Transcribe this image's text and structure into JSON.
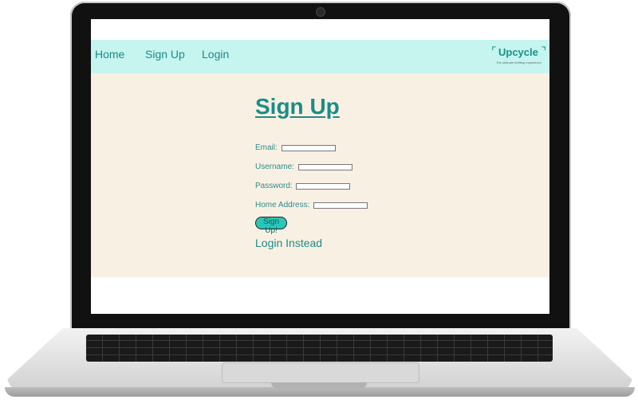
{
  "nav": {
    "home": "Home",
    "signup": "Sign Up",
    "login": "Login"
  },
  "logo": {
    "name": "Upcycle",
    "tagline": "The ultimate thrifting experience"
  },
  "page": {
    "title": "Sign Up"
  },
  "form": {
    "email_label": "Email:",
    "username_label": "Username:",
    "password_label": "Password:",
    "address_label": "Home Address:",
    "email_value": "",
    "username_value": "",
    "password_value": "",
    "address_value": "",
    "submit_label": "Sign Up!",
    "alt_link": "Login Instead"
  },
  "colors": {
    "accent": "#1b8c86",
    "navbar_bg": "#c6f4ef",
    "content_bg": "#f9f0e4",
    "button_bg": "#2cc5b9"
  }
}
